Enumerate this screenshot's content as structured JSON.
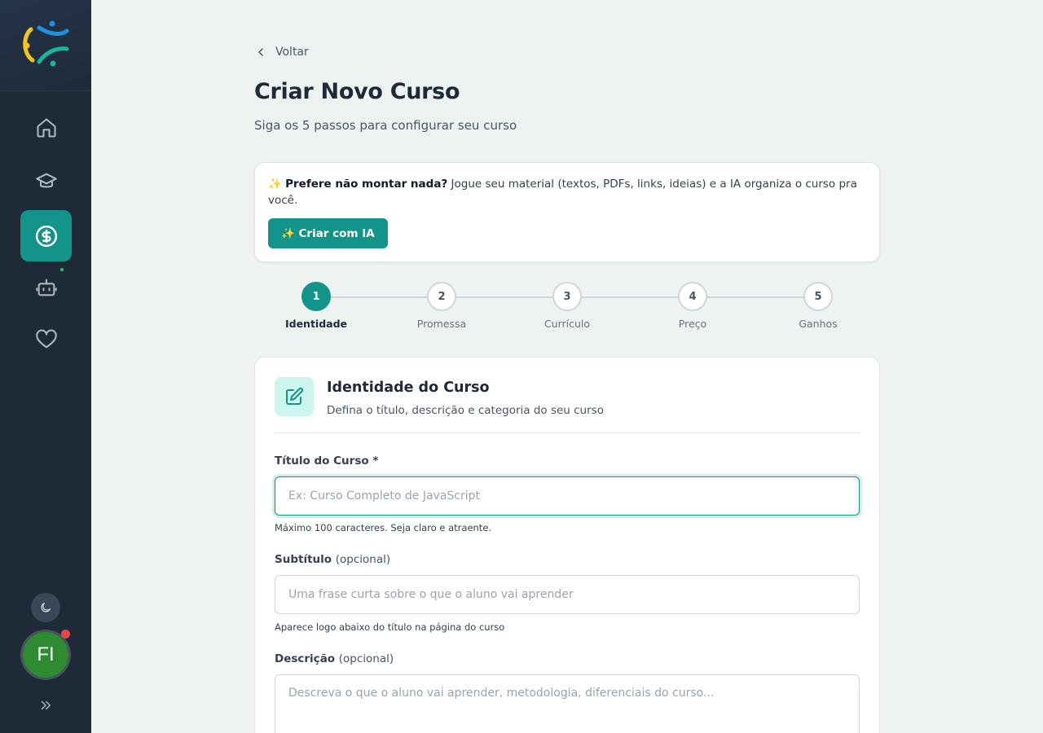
{
  "sidebar": {
    "nav": [
      {
        "id": "home",
        "icon": "home-icon"
      },
      {
        "id": "courses",
        "icon": "graduation-cap-icon"
      },
      {
        "id": "earnings",
        "icon": "dollar-circle-icon",
        "active": true
      },
      {
        "id": "ai-bot",
        "icon": "bot-icon"
      },
      {
        "id": "favorites",
        "icon": "heart-icon"
      }
    ],
    "avatar_initials": "FI"
  },
  "header": {
    "back_label": "Voltar",
    "title": "Criar Novo Curso",
    "subtitle": "Siga os 5 passos para configurar seu curso"
  },
  "ai_card": {
    "emoji": "✨",
    "headline": "Prefere não montar nada?",
    "text": " Jogue seu material (textos, PDFs, links, ideias) e a IA organiza o curso pra você.",
    "button_label": "✨ Criar com IA"
  },
  "stepper": {
    "steps": [
      {
        "number": "1",
        "label": "Identidade"
      },
      {
        "number": "2",
        "label": "Promessa"
      },
      {
        "number": "3",
        "label": "Currículo"
      },
      {
        "number": "4",
        "label": "Preço"
      },
      {
        "number": "5",
        "label": "Ganhos"
      }
    ],
    "active_index": 0
  },
  "form": {
    "section_title": "Identidade do Curso",
    "section_subtitle": "Defina o título, descrição e categoria do seu curso",
    "title_field": {
      "label": "Título do Curso *",
      "placeholder": "Ex: Curso Completo de JavaScript",
      "value": "",
      "hint": "Máximo 100 caracteres. Seja claro e atraente."
    },
    "subtitle_field": {
      "label": "Subtítulo",
      "optional": "(opcional)",
      "placeholder": "Uma frase curta sobre o que o aluno vai aprender",
      "value": "",
      "hint": "Aparece logo abaixo do título na página do curso"
    },
    "description_field": {
      "label": "Descrição",
      "optional": "(opcional)",
      "placeholder": "Descreva o que o aluno vai aprender, metodologia, diferenciais do curso...",
      "value": ""
    }
  },
  "colors": {
    "accent": "#12948a",
    "sidebar_bg": "#1e2a38",
    "page_bg": "#eef2f1"
  }
}
